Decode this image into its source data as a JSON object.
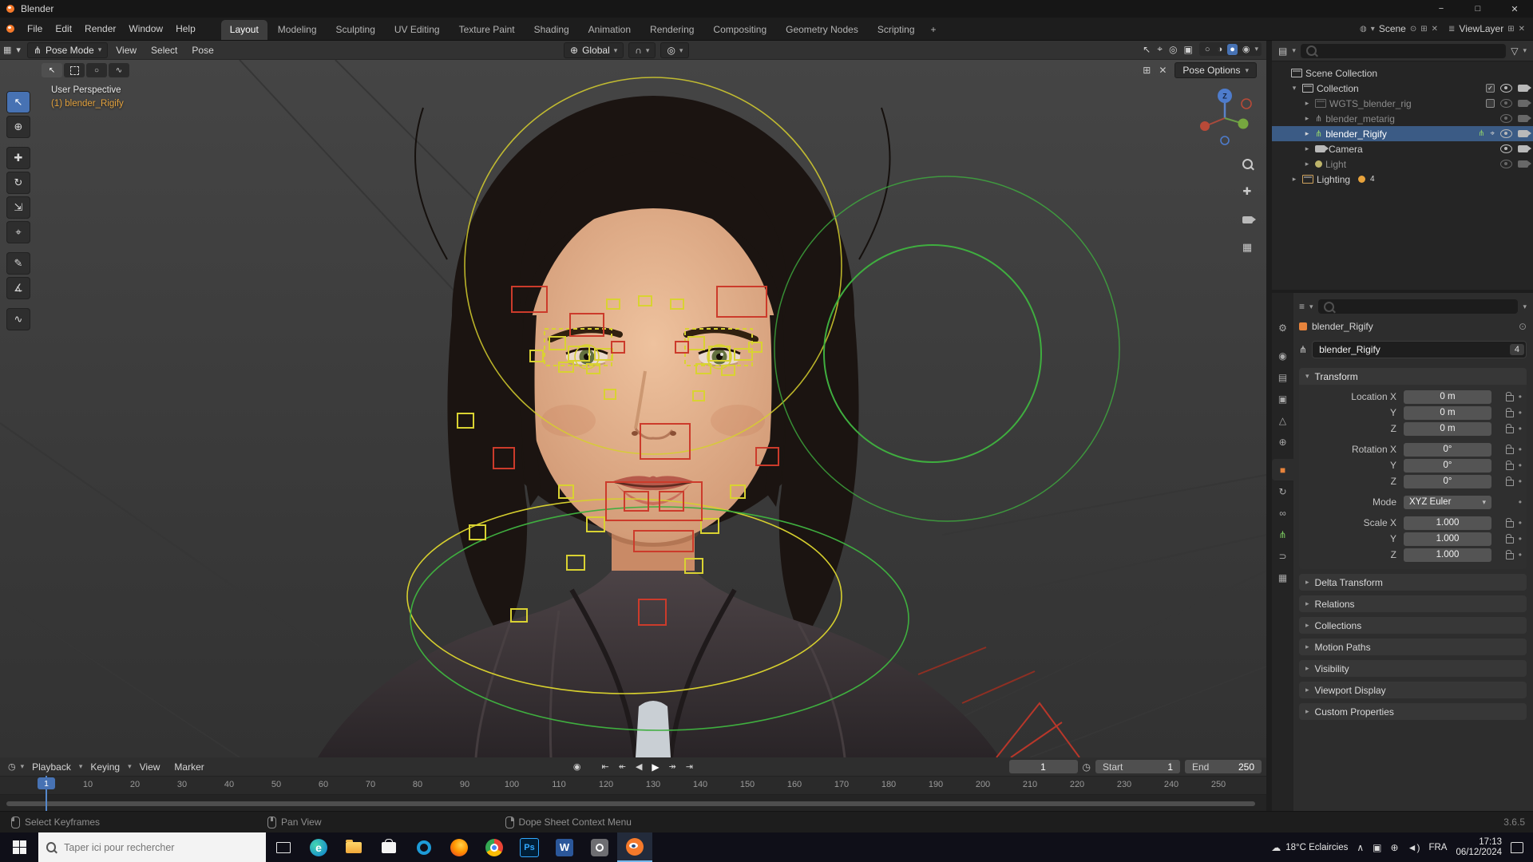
{
  "window": {
    "title": "Blender"
  },
  "icons": {
    "minimize": "−",
    "maximize": "□",
    "close": "✕",
    "chevron_down": "▾",
    "chevron_right": "▸",
    "chevron_up": "∧",
    "plus": "+",
    "pin": "⊙",
    "duplicate": "⊞",
    "layers": "≣",
    "scene": "◍",
    "editor_grid": "▦",
    "armature": "⋔",
    "select_arrow": "↖",
    "circle": "○",
    "lasso": "∿",
    "globe": "⊕",
    "magnet": "∩",
    "proportional": "◎",
    "target": "⌖",
    "xray": "▣",
    "shade_wire": "○",
    "shade_solid": "◑",
    "shade_material": "●",
    "shade_render": "◉",
    "pan": "✚",
    "clock": "◷",
    "record": "◉",
    "jump_start": "⇤",
    "key_prev": "↞",
    "play_rev": "◀",
    "play": "▶",
    "key_next": "↠",
    "jump_end": "⇥",
    "list": "▤",
    "funnel": "▽",
    "props": "≡",
    "check": "✓",
    "dot": "•",
    "cloud": "☁",
    "network": "⊕",
    "speaker": "◄)",
    "grid": "▦",
    "fullscreen": "⊞"
  },
  "topbar": {
    "menus": [
      "File",
      "Edit",
      "Render",
      "Window",
      "Help"
    ],
    "workspaces": [
      "Layout",
      "Modeling",
      "Sculpting",
      "UV Editing",
      "Texture Paint",
      "Shading",
      "Animation",
      "Rendering",
      "Compositing",
      "Geometry Nodes",
      "Scripting"
    ],
    "scene_label": "Scene",
    "viewlayer_label": "ViewLayer"
  },
  "viewport": {
    "mode": "Pose Mode",
    "menu_view": "View",
    "menu_select": "Select",
    "menu_pose": "Pose",
    "orientation": "Global",
    "pose_options": "Pose Options",
    "overlay_line1": "User Perspective",
    "overlay_line2": "(1) blender_Rigify",
    "gizmo_z": "Z"
  },
  "toolbar": {
    "tools": [
      "↖",
      "⊕",
      "✚",
      "↻",
      "⇲",
      "⌖",
      "✎",
      "∡",
      "∿"
    ]
  },
  "prop_tabs": [
    "⚙",
    "◉",
    "▤",
    "▣",
    "△",
    "⊕",
    "■",
    "↻",
    "∞",
    "⋔",
    "⊃",
    "▦"
  ],
  "outliner": {
    "rows": [
      {
        "label": "Scene Collection"
      },
      {
        "label": "Collection"
      },
      {
        "label": "WGTS_blender_rig"
      },
      {
        "label": "blender_metarig"
      },
      {
        "label": "blender_Rigify"
      },
      {
        "label": "Camera"
      },
      {
        "label": "Light"
      },
      {
        "label": "Lighting",
        "badge": "4"
      }
    ]
  },
  "properties": {
    "breadcrumb": "blender_Rigify",
    "name": "blender_Rigify",
    "users": "4",
    "transform_title": "Transform",
    "rows": [
      {
        "label": "Location X",
        "value": "0 m"
      },
      {
        "label": "Y",
        "value": "0 m"
      },
      {
        "label": "Z",
        "value": "0 m"
      },
      {
        "label": "Rotation X",
        "value": "0°"
      },
      {
        "label": "Y",
        "value": "0°"
      },
      {
        "label": "Z",
        "value": "0°"
      },
      {
        "label": "Mode",
        "value": "XYZ Euler"
      },
      {
        "label": "Scale X",
        "value": "1.000"
      },
      {
        "label": "Y",
        "value": "1.000"
      },
      {
        "label": "Z",
        "value": "1.000"
      }
    ],
    "sections": [
      "Delta Transform",
      "Relations",
      "Collections",
      "Motion Paths",
      "Visibility",
      "Viewport Display",
      "Custom Properties"
    ]
  },
  "timeline": {
    "menu_playback": "Playback",
    "menu_keying": "Keying",
    "menu_view": "View",
    "menu_marker": "Marker",
    "frame": "1",
    "marker": "1",
    "start_label": "Start",
    "start_value": "1",
    "end_label": "End",
    "end_value": "250",
    "ruler": [
      "1",
      "10",
      "20",
      "30",
      "40",
      "50",
      "60",
      "70",
      "80",
      "90",
      "100",
      "110",
      "120",
      "130",
      "140",
      "150",
      "160",
      "170",
      "180",
      "190",
      "200",
      "210",
      "220",
      "230",
      "240",
      "250"
    ]
  },
  "statusbar": {
    "hint1": "Select Keyframes",
    "hint2": "Pan View",
    "hint3": "Dope Sheet Context Menu",
    "version": "3.6.5"
  },
  "taskbar": {
    "search_placeholder": "Taper ici pour rechercher",
    "weather": "18°C Eclaircies",
    "lang": "FRA",
    "time": "17:13",
    "date": "06/12/2024",
    "ps": "Ps",
    "word": "W",
    "edge": "e"
  }
}
